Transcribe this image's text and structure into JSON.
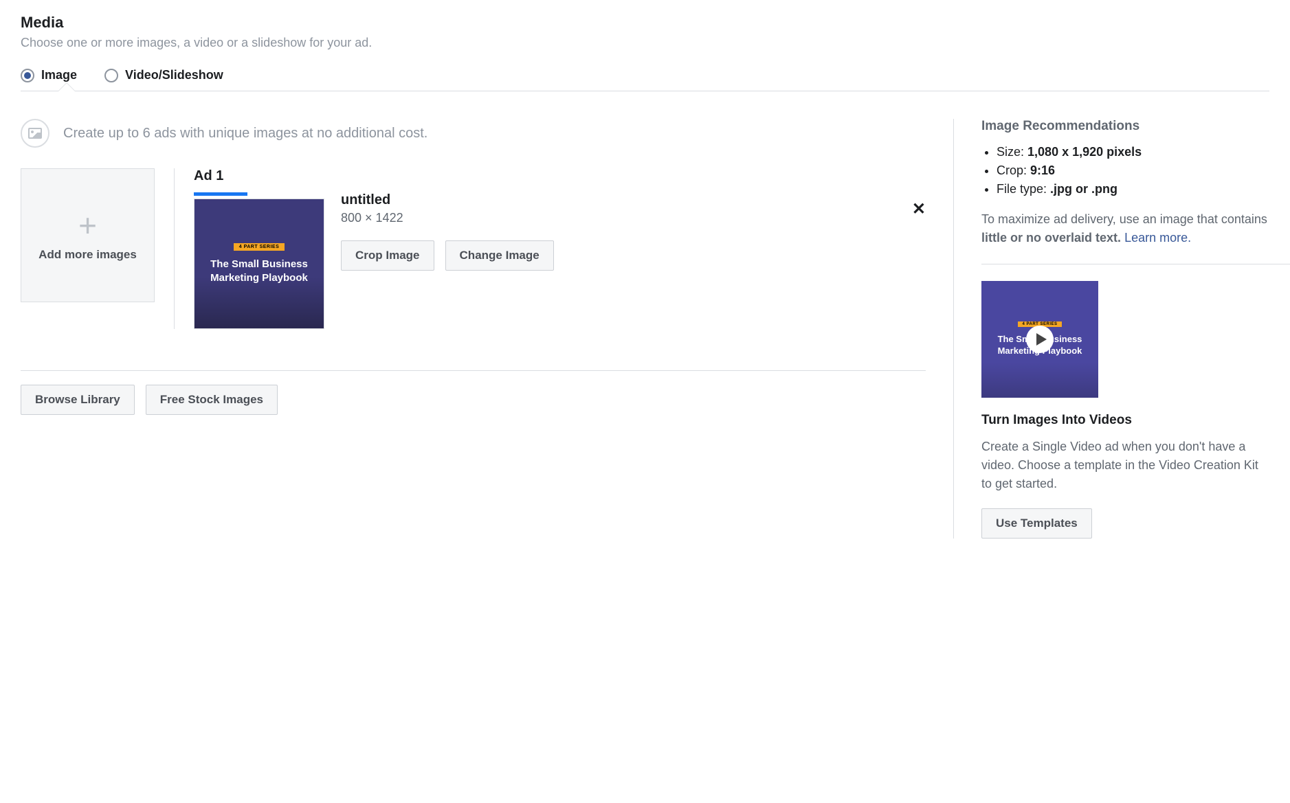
{
  "header": {
    "title": "Media",
    "subtitle": "Choose one or more images, a video or a slideshow for your ad."
  },
  "tabs": {
    "image": "Image",
    "video": "Video/Slideshow"
  },
  "main": {
    "info_text": "Create up to 6 ads with unique images at no additional cost.",
    "add_more_label": "Add more images",
    "ad": {
      "title": "Ad 1",
      "filename": "untitled",
      "dimensions": "800 × 1422",
      "crop_label": "Crop Image",
      "change_label": "Change Image",
      "thumb_badge": "4 PART SERIES",
      "thumb_line1": "The Small Business",
      "thumb_line2": "Marketing Playbook"
    },
    "browse_library_label": "Browse Library",
    "free_stock_label": "Free Stock Images"
  },
  "sidebar": {
    "recommendations_title": "Image Recommendations",
    "recs": {
      "size_label": "Size: ",
      "size_value": "1,080 x 1,920 pixels",
      "crop_label": "Crop: ",
      "crop_value": "9:16",
      "filetype_label": "File type: ",
      "filetype_value": ".jpg or .png"
    },
    "desc_pre": "To maximize ad delivery, use an image that contains ",
    "desc_bold": "little or no overlaid text.",
    "learn_more": "Learn more.",
    "video": {
      "title": "Turn Images Into Videos",
      "desc": "Create a Single Video ad when you don't have a video. Choose a template in the Video Creation Kit to get started.",
      "button_label": "Use Templates",
      "thumb_badge": "4 PART SERIES",
      "thumb_line1": "The Small Business",
      "thumb_line2": "Marketing Playbook"
    }
  }
}
